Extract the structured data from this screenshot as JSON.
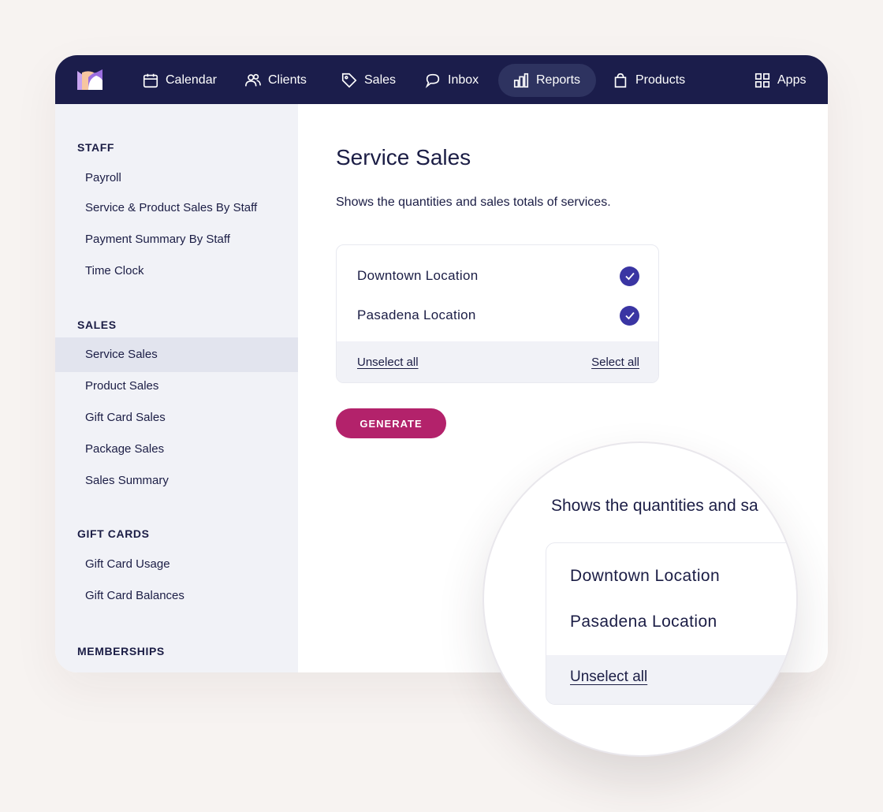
{
  "nav": {
    "items": [
      {
        "label": "Calendar",
        "icon": "calendar-icon"
      },
      {
        "label": "Clients",
        "icon": "clients-icon"
      },
      {
        "label": "Sales",
        "icon": "tag-icon"
      },
      {
        "label": "Inbox",
        "icon": "chat-icon"
      },
      {
        "label": "Reports",
        "icon": "bar-chart-icon",
        "active": true
      },
      {
        "label": "Products",
        "icon": "shopping-bag-icon"
      },
      {
        "label": "Apps",
        "icon": "grid-icon"
      }
    ]
  },
  "sidebar": {
    "sections": [
      {
        "title": "STAFF",
        "items": [
          "Payroll",
          "Service & Product Sales By Staff",
          "Payment Summary By Staff",
          "Time Clock"
        ]
      },
      {
        "title": "SALES",
        "items": [
          "Service Sales",
          "Product Sales",
          "Gift Card Sales",
          "Package Sales",
          "Sales Summary"
        ]
      },
      {
        "title": "GIFT CARDS",
        "items": [
          "Gift Card Usage",
          "Gift Card Balances"
        ]
      },
      {
        "title": "MEMBERSHIPS",
        "items": []
      }
    ],
    "active_item": "Service Sales"
  },
  "main": {
    "title": "Service Sales",
    "description": "Shows the quantities and sales totals of services.",
    "locations": [
      {
        "name": "Downtown Location",
        "checked": true
      },
      {
        "name": "Pasadena Location",
        "checked": true
      }
    ],
    "unselect_all": "Unselect all",
    "select_all": "Select all",
    "generate": "GENERATE"
  },
  "magnifier": {
    "description": "Shows the quantities and sa",
    "locations": [
      "Downtown Location",
      "Pasadena Location"
    ],
    "unselect_all": "Unselect all"
  },
  "colors": {
    "nav_bg": "#1b1d4b",
    "accent": "#3a35a3",
    "generate_bg": "#b3226b",
    "sidebar_bg": "#f1f2f7"
  }
}
